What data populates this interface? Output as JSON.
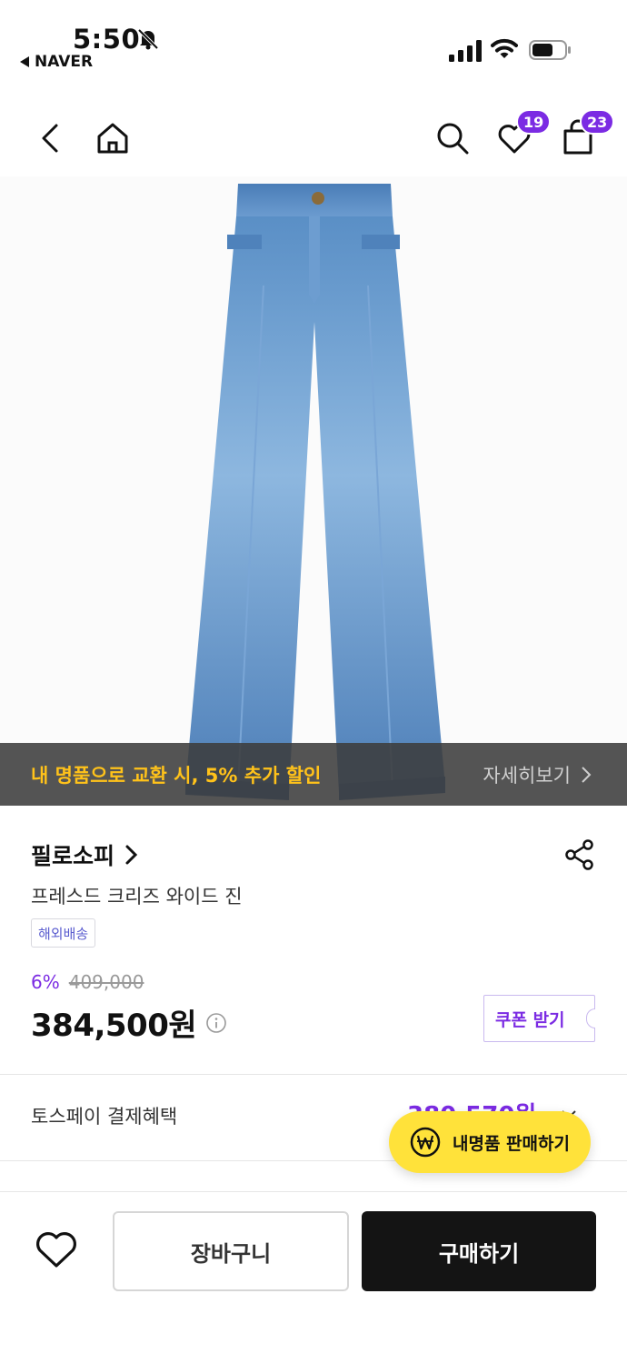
{
  "status_bar": {
    "time": "5:50",
    "back_app": "NAVER"
  },
  "header": {
    "wishlist_count": "19",
    "cart_count": "23"
  },
  "promo_banner": {
    "text": "내 명품으로 교환 시, 5% 추가 할인",
    "detail_label": "자세히보기"
  },
  "product": {
    "brand": "필로소피",
    "name": "프레스드 크리즈 와이드 진",
    "shipping_tag": "해외배송",
    "discount_rate": "6%",
    "original_price": "409,000",
    "price": "384,500원",
    "coupon_label": "쿠폰 받기"
  },
  "payment_benefit": {
    "label": "토스페이 결제혜택",
    "value": "380,570원"
  },
  "sell_button": {
    "label": "내명품 판매하기"
  },
  "bottom_bar": {
    "cart_label": "장바구니",
    "buy_label": "구매하기"
  },
  "colors": {
    "accent": "#7b2be3",
    "promo_text": "#ffc21a",
    "sell_button_bg": "#ffe23a",
    "buy_button_bg": "#141414"
  }
}
